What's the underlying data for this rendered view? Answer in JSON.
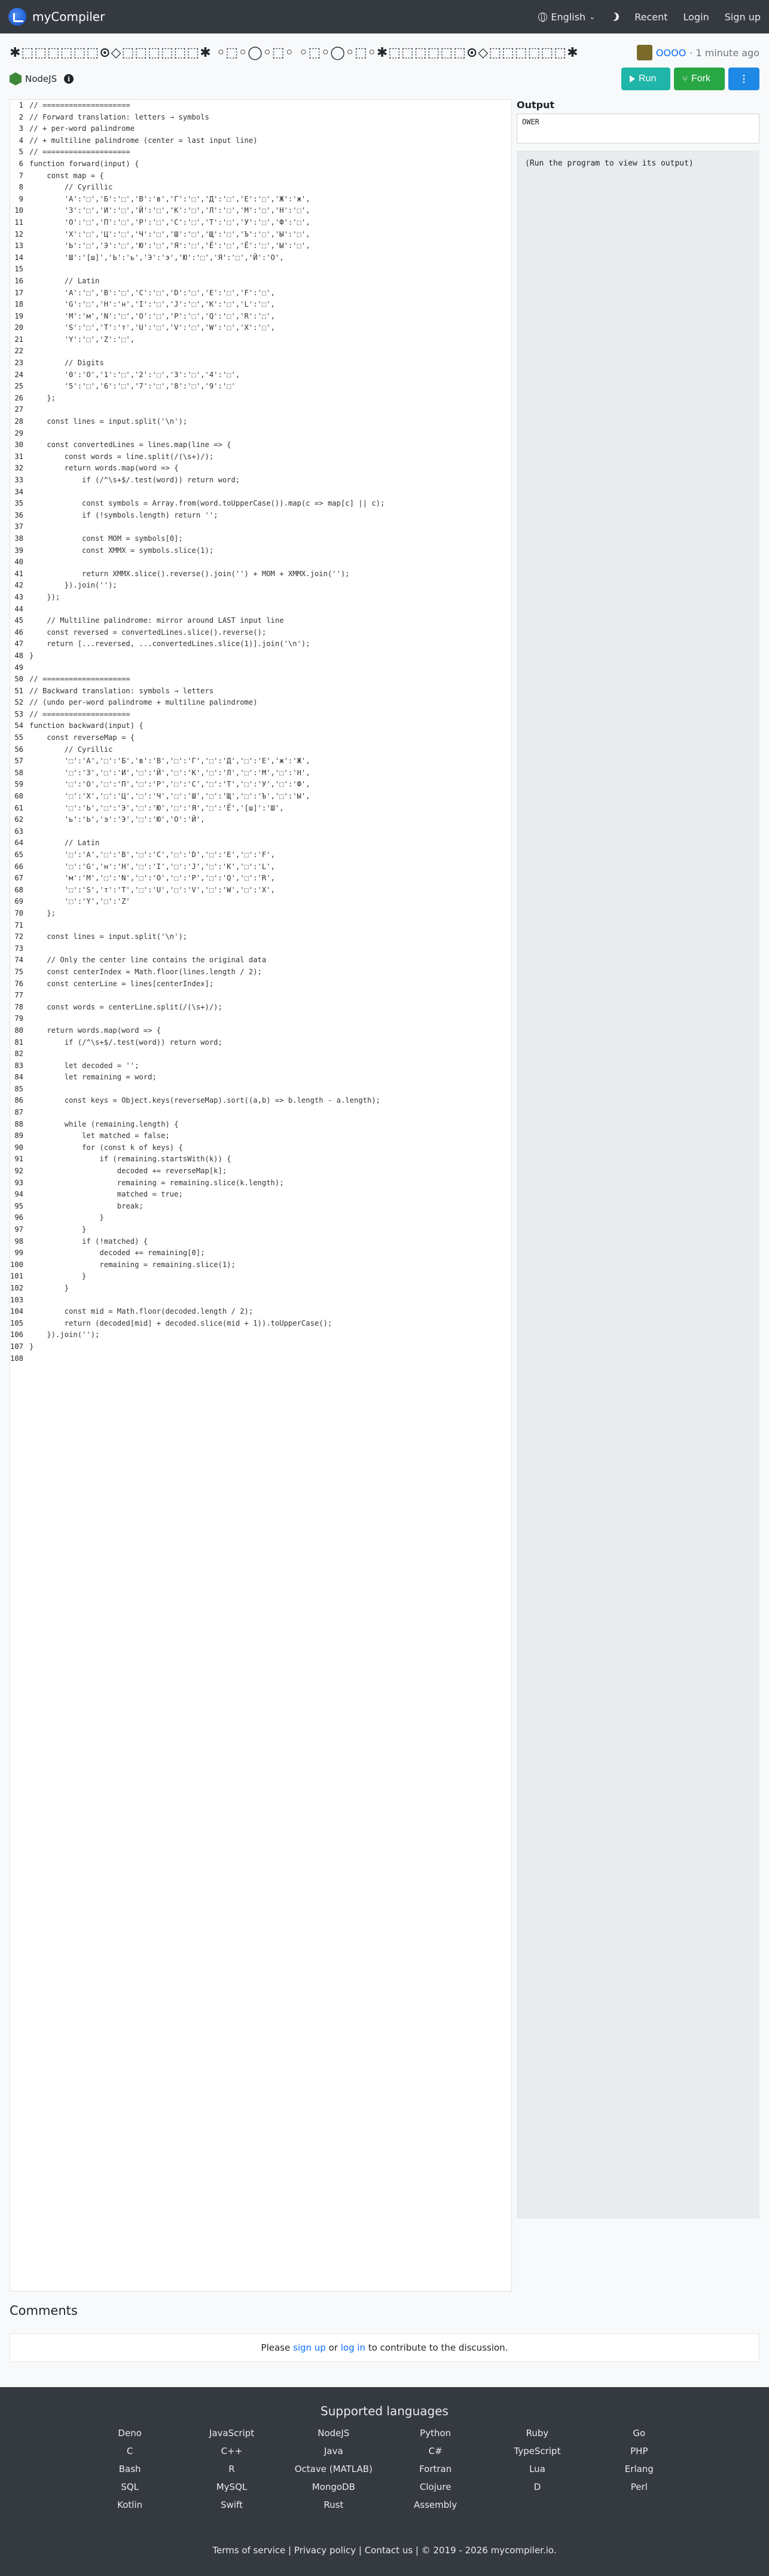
{
  "navbar": {
    "brand": "myCompiler",
    "language": "English",
    "recent": "Recent",
    "login": "Login",
    "signup": "Sign up"
  },
  "title": "✱⬚⬚⬚⬚⬚⬚⊙◇⬚⬚⬚⬚⬚⬚✱ ◦⬚◦◯◦⬚◦  ◦⬚◦◯◦⬚◦✱⬚⬚⬚⬚⬚⬚⊙◇⬚⬚⬚⬚⬚⬚✱",
  "author": {
    "name": "OOOO",
    "time": "· 1 minute ago"
  },
  "language_badge": "NodeJS",
  "info_icon": "i",
  "actions": {
    "run": "Run",
    "fork": "Fork",
    "more": "⋮"
  },
  "code_lines": [
    "// ====================",
    "// Forward translation: letters → symbols",
    "// + per-word palindrome",
    "// + multiline palindrome (center = last input line)",
    "// ====================",
    "function forward(input) {",
    "    const map = {",
    "        // Cyrillic",
    "        'А':'⬚','Б':'⬚','В':'ʙ','Г':'⬚','Д':'⬚','Е':'⬚','Ж':'ж',",
    "        'З':'⬚','И':'⬚','Й':'⬚','К':'⬚','Л':'⬚','М':'⬚','Н':'⬚',",
    "        'О':'⬚','П':'⬚','Р':'⬚','С':'⬚','Т':'⬚','У':'⬚','Ф':'⬚',",
    "        'Х':'⬚','Ц':'⬚','Ч':'⬚','Ш':'⬚','Щ':'⬚','Ъ':'⬚','Ы':'⬚',",
    "        'Ь':'⬚','Э':'⬚','Ю':'⬚','Я':'⬚','Ё':'⬚','Ё':'⬚','Ы':'⬚',",
    "        'Ш':'[ш]','Ь':'ь','Э':'э','Ю':'⬚','Я':'⬚','Й':'Ο',",
    "",
    "        // Latin",
    "        'A':'⬚','B':'⬚','C':'⬚','D':'⬚','E':'⬚','F':'⬚',",
    "        'G':'⬚','H':'н','I':'⬚','J':'⬚','K':'⬚','L':'⬚',",
    "        'M':'м','N':'⬚','O':'⬚','P':'⬚','Q':'⬚','R':'⬚',",
    "        'S':'⬚','T':'т','U':'⬚','V':'⬚','W':'⬚','X':'⬚',",
    "        'Y':'⬚','Z':'⬚',",
    "",
    "        // Digits",
    "        '0':'O','1':'⬚','2':'⬚','3':'⬚','4':'⬚',",
    "        '5':'⬚','6':'⬚','7':'⬚','8':'⬚','9':'⬚'",
    "    };",
    "",
    "    const lines = input.split('\\n');",
    "",
    "    const convertedLines = lines.map(line => {",
    "        const words = line.split(/(\\s+)/);",
    "        return words.map(word => {",
    "            if (/^\\s+$/.test(word)) return word;",
    "",
    "            const symbols = Array.from(word.toUpperCase()).map(c => map[c] || c);",
    "            if (!symbols.length) return '';",
    "",
    "            const MOM = symbols[0];",
    "            const XMMX = symbols.slice(1);",
    "",
    "            return XMMX.slice().reverse().join('') + MOM + XMMX.join('');",
    "        }).join('');",
    "    });",
    "",
    "    // Multiline palindrome: mirror around LAST input line",
    "    const reversed = convertedLines.slice().reverse();",
    "    return [...reversed, ...convertedLines.slice(1)].join('\\n');",
    "}",
    "",
    "// ====================",
    "// Backward translation: symbols → letters",
    "// (undo per-word palindrome + multiline palindrome)",
    "// ====================",
    "function backward(input) {",
    "    const reverseMap = {",
    "        // Cyrillic",
    "        '⬚':'А','⬚':'Б','ʙ':'В','⬚':'Г','⬚':'Д','⬚':'Е','ж':'Ж',",
    "        '⬚':'З','⬚':'И','⬚':'Й','⬚':'К','⬚':'Л','⬚':'М','⬚':'Н',",
    "        '⬚':'О','⬚':'П','⬚':'Р','⬚':'С','⬚':'Т','⬚':'У','⬚':'Ф',",
    "        '⬚':'Х','⬚':'Ц','⬚':'Ч','⬚':'Ш','⬚':'Щ','⬚':'Ъ','⬚':'Ы',",
    "        '⬚':'Ь','⬚':'Э','⬚':'Ю','⬚':'Я','⬚':'Ё','[ш]':'Ш',",
    "        'ь':'Ь','э':'Э','⬚':'Ю','Ο':'Й',",
    "",
    "        // Latin",
    "        '⬚':'A','⬚':'B','⬚':'C','⬚':'D','⬚':'E','⬚':'F',",
    "        '⬚':'G','н':'H','⬚':'I','⬚':'J','⬚':'K','⬚':'L',",
    "        'м':'M','⬚':'N','⬚':'O','⬚':'P','⬚':'Q','⬚':'R',",
    "        '⬚':'S','т':'T','⬚':'U','⬚':'V','⬚':'W','⬚':'X',",
    "        '⬚':'Y','⬚':'Z'",
    "    };",
    "",
    "    const lines = input.split('\\n');",
    "",
    "    // Only the center line contains the original data",
    "    const centerIndex = Math.floor(lines.length / 2);",
    "    const centerLine = lines[centerIndex];",
    "",
    "    const words = centerLine.split(/(\\s+)/);",
    "",
    "    return words.map(word => {",
    "        if (/^\\s+$/.test(word)) return word;",
    "",
    "        let decoded = '';",
    "        let remaining = word;",
    "",
    "        const keys = Object.keys(reverseMap).sort((a,b) => b.length - a.length);",
    "",
    "        while (remaining.length) {",
    "            let matched = false;",
    "            for (const k of keys) {",
    "                if (remaining.startsWith(k)) {",
    "                    decoded += reverseMap[k];",
    "                    remaining = remaining.slice(k.length);",
    "                    matched = true;",
    "                    break;",
    "                }",
    "            }",
    "            if (!matched) {",
    "                decoded += remaining[0];",
    "                remaining = remaining.slice(1);",
    "            }",
    "        }",
    "",
    "        const mid = Math.floor(decoded.length / 2);",
    "        return (decoded[mid] + decoded.slice(mid + 1)).toUpperCase();",
    "    }).join('');",
    "}",
    ""
  ],
  "output": {
    "label": "Output",
    "stdin_value": "OWER",
    "placeholder": "(Run the program to view its output)"
  },
  "comments": {
    "title": "Comments",
    "please": "Please",
    "sign_up": "sign up",
    "or": "or",
    "log_in": "log in",
    "suffix": "to contribute to the discussion."
  },
  "footer": {
    "title": "Supported languages",
    "languages": [
      "Deno",
      "JavaScript",
      "NodeJS",
      "Python",
      "Ruby",
      "Go",
      "C",
      "C++",
      "Java",
      "C#",
      "TypeScript",
      "PHP",
      "Bash",
      "R",
      "Octave (MATLAB)",
      "Fortran",
      "Lua",
      "Erlang",
      "SQL",
      "MySQL",
      "MongoDB",
      "Clojure",
      "D",
      "Perl",
      "Kotlin",
      "Swift",
      "Rust",
      "Assembly"
    ],
    "links": "Terms of service | Privacy policy | Contact us | © 2019 - 2026 mycompiler.io."
  }
}
